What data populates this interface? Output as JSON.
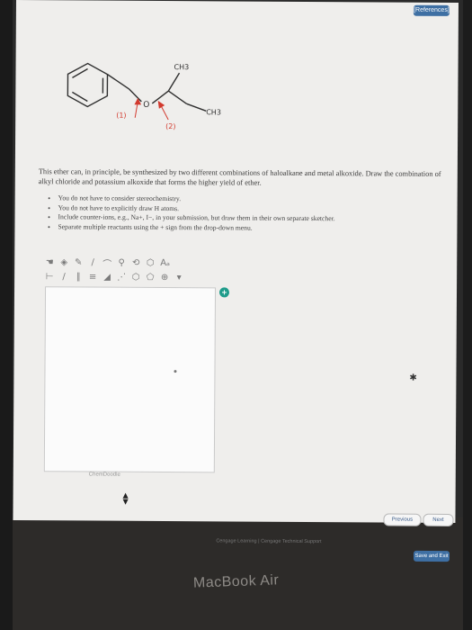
{
  "header": {
    "references_label": "[References]"
  },
  "molecule": {
    "label_ch3_top": "CH3",
    "label_ch3_bottom": "CH3",
    "label_o": "O",
    "bond1_label": "(1)",
    "bond2_label": "(2)",
    "arrow_color": "#d23a2f"
  },
  "question": {
    "intro": "This ether can, in principle, be synthesized by two different combinations of haloalkane and metal alkoxide. Draw the combination of alkyl chloride and potassium alkoxide that forms the higher yield of ether.",
    "notes": [
      "You do not have to consider stereochemistry.",
      "You do not have to explicitly draw H atoms.",
      "Include counter-ions, e.g., Na+, I−, in your submission, but draw them in their own separate sketcher.",
      "Separate multiple reactants using the + sign from the drop-down menu."
    ]
  },
  "sketcher": {
    "toolbar_row1": [
      "pointer",
      "eraser",
      "pencil",
      "bond",
      "lasso",
      "zoom",
      "template",
      "ring",
      "text-label"
    ],
    "toolbar_row2": [
      "chain",
      "bond-single",
      "bond-double",
      "bond-triple",
      "bond-wedge",
      "bond-hash",
      "ring-6",
      "ring-5",
      "charge",
      "more"
    ],
    "credit": "ChemDoodle",
    "add_sketcher_symbol": "+"
  },
  "navigation": {
    "previous_label": "Previous",
    "next_label": "Next",
    "save_label": "Save and Exit"
  },
  "footer": {
    "text": "Cengage Learning | Cengage Technical Support"
  },
  "device": {
    "label": "MacBook Air"
  },
  "colors": {
    "screen_bg": "#efeeec",
    "accent": "#3e6fa3",
    "plus_badge": "#1f9c8b"
  }
}
